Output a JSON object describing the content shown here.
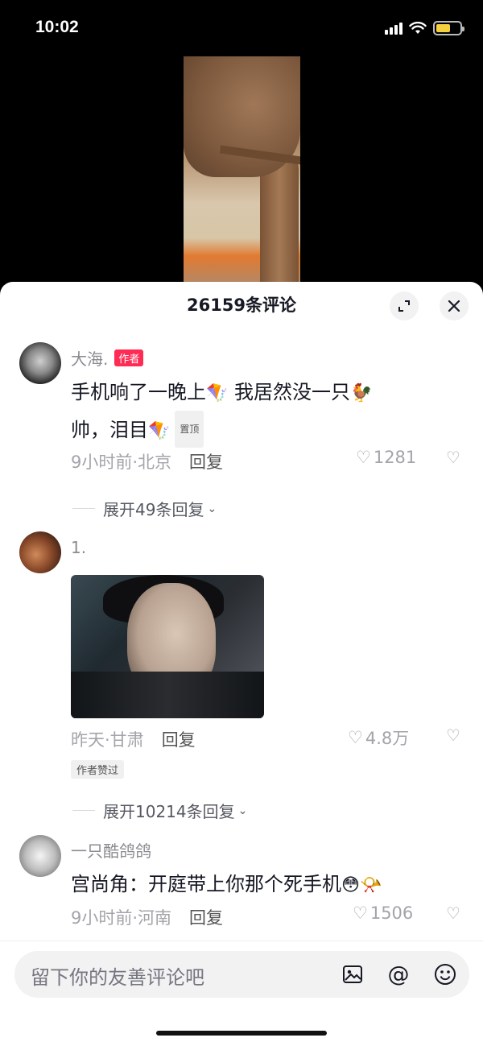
{
  "status_bar": {
    "time": "10:02"
  },
  "sheet": {
    "title": "26159条评论"
  },
  "comments": [
    {
      "username": "大海.",
      "author_tag": "作者",
      "text_line1": "手机响了一晚上",
      "text_line1b": " 我居然没一只",
      "text_line2": "帅，泪目",
      "pinned": "置顶",
      "meta": "9小时前·北京",
      "reply": "回复",
      "likes": "1281",
      "expand": "展开49条回复"
    },
    {
      "username": "1.",
      "meta": "昨天·甘肃",
      "reply": "回复",
      "likes": "4.8万",
      "author_liked": "作者赞过",
      "expand": "展开10214条回复"
    },
    {
      "username": "一只酷鸽鸽",
      "text": "宫尚角：开庭带上你那个死手机",
      "meta": "9小时前·河南",
      "reply": "回复",
      "likes": "1506"
    }
  ],
  "input": {
    "placeholder": "留下你的友善评论吧"
  },
  "icons": [
    "signal-icon",
    "wifi-icon",
    "battery-icon",
    "expand-icon",
    "close-icon",
    "heart-icon",
    "dislike-icon",
    "image-icon",
    "at-icon",
    "emoji-icon"
  ],
  "colors": {
    "author_tag": "#fe2c55",
    "battery": "#f4d03f"
  }
}
